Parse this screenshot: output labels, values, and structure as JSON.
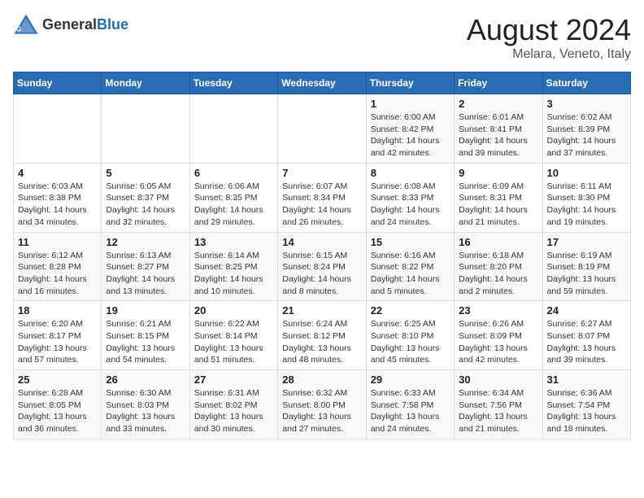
{
  "header": {
    "logo_general": "General",
    "logo_blue": "Blue",
    "title": "August 2024",
    "subtitle": "Melara, Veneto, Italy"
  },
  "days_of_week": [
    "Sunday",
    "Monday",
    "Tuesday",
    "Wednesday",
    "Thursday",
    "Friday",
    "Saturday"
  ],
  "weeks": [
    [
      {
        "day": "",
        "info": ""
      },
      {
        "day": "",
        "info": ""
      },
      {
        "day": "",
        "info": ""
      },
      {
        "day": "",
        "info": ""
      },
      {
        "day": "1",
        "info": "Sunrise: 6:00 AM\nSunset: 8:42 PM\nDaylight: 14 hours\nand 42 minutes."
      },
      {
        "day": "2",
        "info": "Sunrise: 6:01 AM\nSunset: 8:41 PM\nDaylight: 14 hours\nand 39 minutes."
      },
      {
        "day": "3",
        "info": "Sunrise: 6:02 AM\nSunset: 8:39 PM\nDaylight: 14 hours\nand 37 minutes."
      }
    ],
    [
      {
        "day": "4",
        "info": "Sunrise: 6:03 AM\nSunset: 8:38 PM\nDaylight: 14 hours\nand 34 minutes."
      },
      {
        "day": "5",
        "info": "Sunrise: 6:05 AM\nSunset: 8:37 PM\nDaylight: 14 hours\nand 32 minutes."
      },
      {
        "day": "6",
        "info": "Sunrise: 6:06 AM\nSunset: 8:35 PM\nDaylight: 14 hours\nand 29 minutes."
      },
      {
        "day": "7",
        "info": "Sunrise: 6:07 AM\nSunset: 8:34 PM\nDaylight: 14 hours\nand 26 minutes."
      },
      {
        "day": "8",
        "info": "Sunrise: 6:08 AM\nSunset: 8:33 PM\nDaylight: 14 hours\nand 24 minutes."
      },
      {
        "day": "9",
        "info": "Sunrise: 6:09 AM\nSunset: 8:31 PM\nDaylight: 14 hours\nand 21 minutes."
      },
      {
        "day": "10",
        "info": "Sunrise: 6:11 AM\nSunset: 8:30 PM\nDaylight: 14 hours\nand 19 minutes."
      }
    ],
    [
      {
        "day": "11",
        "info": "Sunrise: 6:12 AM\nSunset: 8:28 PM\nDaylight: 14 hours\nand 16 minutes."
      },
      {
        "day": "12",
        "info": "Sunrise: 6:13 AM\nSunset: 8:27 PM\nDaylight: 14 hours\nand 13 minutes."
      },
      {
        "day": "13",
        "info": "Sunrise: 6:14 AM\nSunset: 8:25 PM\nDaylight: 14 hours\nand 10 minutes."
      },
      {
        "day": "14",
        "info": "Sunrise: 6:15 AM\nSunset: 8:24 PM\nDaylight: 14 hours\nand 8 minutes."
      },
      {
        "day": "15",
        "info": "Sunrise: 6:16 AM\nSunset: 8:22 PM\nDaylight: 14 hours\nand 5 minutes."
      },
      {
        "day": "16",
        "info": "Sunrise: 6:18 AM\nSunset: 8:20 PM\nDaylight: 14 hours\nand 2 minutes."
      },
      {
        "day": "17",
        "info": "Sunrise: 6:19 AM\nSunset: 8:19 PM\nDaylight: 13 hours\nand 59 minutes."
      }
    ],
    [
      {
        "day": "18",
        "info": "Sunrise: 6:20 AM\nSunset: 8:17 PM\nDaylight: 13 hours\nand 57 minutes."
      },
      {
        "day": "19",
        "info": "Sunrise: 6:21 AM\nSunset: 8:15 PM\nDaylight: 13 hours\nand 54 minutes."
      },
      {
        "day": "20",
        "info": "Sunrise: 6:22 AM\nSunset: 8:14 PM\nDaylight: 13 hours\nand 51 minutes."
      },
      {
        "day": "21",
        "info": "Sunrise: 6:24 AM\nSunset: 8:12 PM\nDaylight: 13 hours\nand 48 minutes."
      },
      {
        "day": "22",
        "info": "Sunrise: 6:25 AM\nSunset: 8:10 PM\nDaylight: 13 hours\nand 45 minutes."
      },
      {
        "day": "23",
        "info": "Sunrise: 6:26 AM\nSunset: 8:09 PM\nDaylight: 13 hours\nand 42 minutes."
      },
      {
        "day": "24",
        "info": "Sunrise: 6:27 AM\nSunset: 8:07 PM\nDaylight: 13 hours\nand 39 minutes."
      }
    ],
    [
      {
        "day": "25",
        "info": "Sunrise: 6:28 AM\nSunset: 8:05 PM\nDaylight: 13 hours\nand 36 minutes."
      },
      {
        "day": "26",
        "info": "Sunrise: 6:30 AM\nSunset: 8:03 PM\nDaylight: 13 hours\nand 33 minutes."
      },
      {
        "day": "27",
        "info": "Sunrise: 6:31 AM\nSunset: 8:02 PM\nDaylight: 13 hours\nand 30 minutes."
      },
      {
        "day": "28",
        "info": "Sunrise: 6:32 AM\nSunset: 8:00 PM\nDaylight: 13 hours\nand 27 minutes."
      },
      {
        "day": "29",
        "info": "Sunrise: 6:33 AM\nSunset: 7:58 PM\nDaylight: 13 hours\nand 24 minutes."
      },
      {
        "day": "30",
        "info": "Sunrise: 6:34 AM\nSunset: 7:56 PM\nDaylight: 13 hours\nand 21 minutes."
      },
      {
        "day": "31",
        "info": "Sunrise: 6:36 AM\nSunset: 7:54 PM\nDaylight: 13 hours\nand 18 minutes."
      }
    ]
  ]
}
